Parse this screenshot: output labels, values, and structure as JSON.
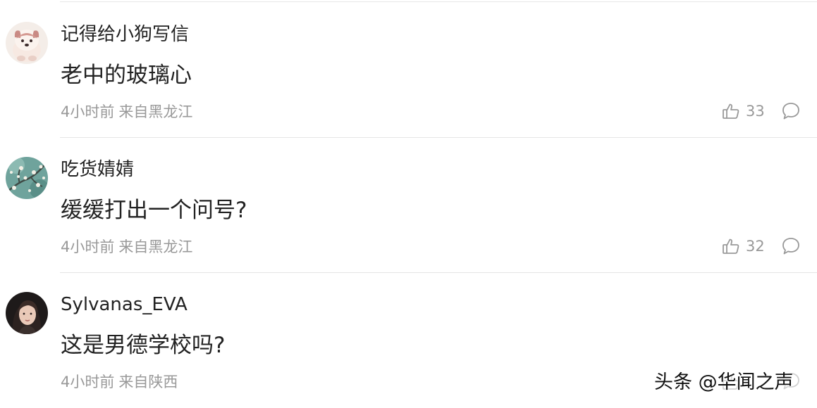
{
  "comments": [
    {
      "username": "记得给小狗写信",
      "content": "老中的玻璃心",
      "time": "4小时前",
      "location": "来自黑龙江",
      "likes": "33",
      "avatar_icon": "puppy-avatar"
    },
    {
      "username": "吃货婧婧",
      "content": "缓缓打出一个问号?",
      "time": "4小时前",
      "location": "来自黑龙江",
      "likes": "32",
      "avatar_icon": "blossom-painting-avatar"
    },
    {
      "username": "Sylvanas_EVA",
      "content": "这是男德学校吗?",
      "time": "4小时前",
      "location": "来自陕西",
      "likes": "",
      "avatar_icon": "portrait-avatar"
    }
  ],
  "watermark": "头条 @华闻之声",
  "colors": {
    "text": "#222222",
    "meta": "#999999",
    "divider": "#e5e5e5"
  }
}
